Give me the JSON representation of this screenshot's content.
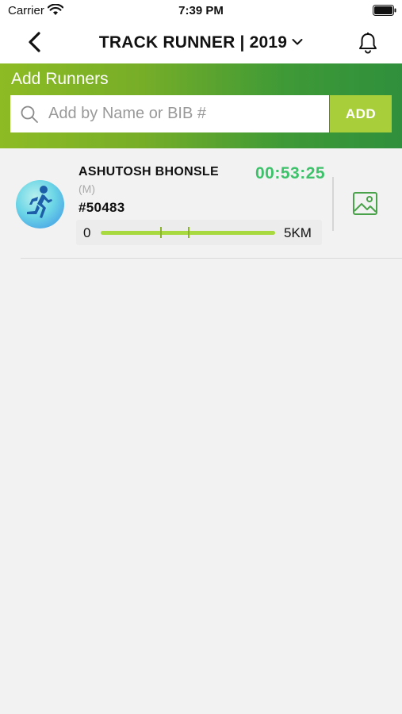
{
  "status_bar": {
    "carrier": "Carrier",
    "time": "7:39 PM"
  },
  "nav": {
    "title": "TRACK RUNNER | 2019"
  },
  "add_section": {
    "title": "Add Runners",
    "search_placeholder": "Add by Name or BIB #",
    "search_value": "",
    "add_label": "ADD"
  },
  "runners": [
    {
      "name": "ASHUTOSH BHONSLE",
      "gender": "(M)",
      "bib": "#50483",
      "time": "00:53:25",
      "progress_start": "0",
      "progress_end": "5KM",
      "checkpoints": [
        0.34,
        0.5
      ]
    }
  ],
  "colors": {
    "accent_green": "#3cc36a",
    "add_button": "#a8cf3a",
    "progress": "#a8d93e",
    "gradient_start": "#8dbb24",
    "gradient_end": "#2f8f3c"
  },
  "icons": {
    "back": "chevron-left-icon",
    "title_dropdown": "chevron-down-icon",
    "notifications": "bell-icon",
    "search": "search-icon",
    "runner_avatar": "runner-icon",
    "photo": "image-icon"
  }
}
